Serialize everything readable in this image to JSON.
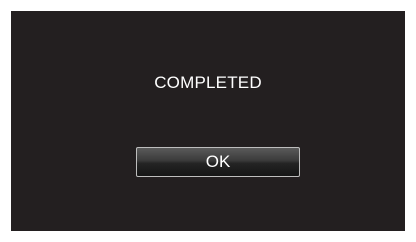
{
  "dialog": {
    "message": "COMPLETED",
    "ok_label": "OK"
  },
  "colors": {
    "screen_background": "#231f20",
    "text": "#ffffff",
    "button_border": "#bdbdbd"
  }
}
